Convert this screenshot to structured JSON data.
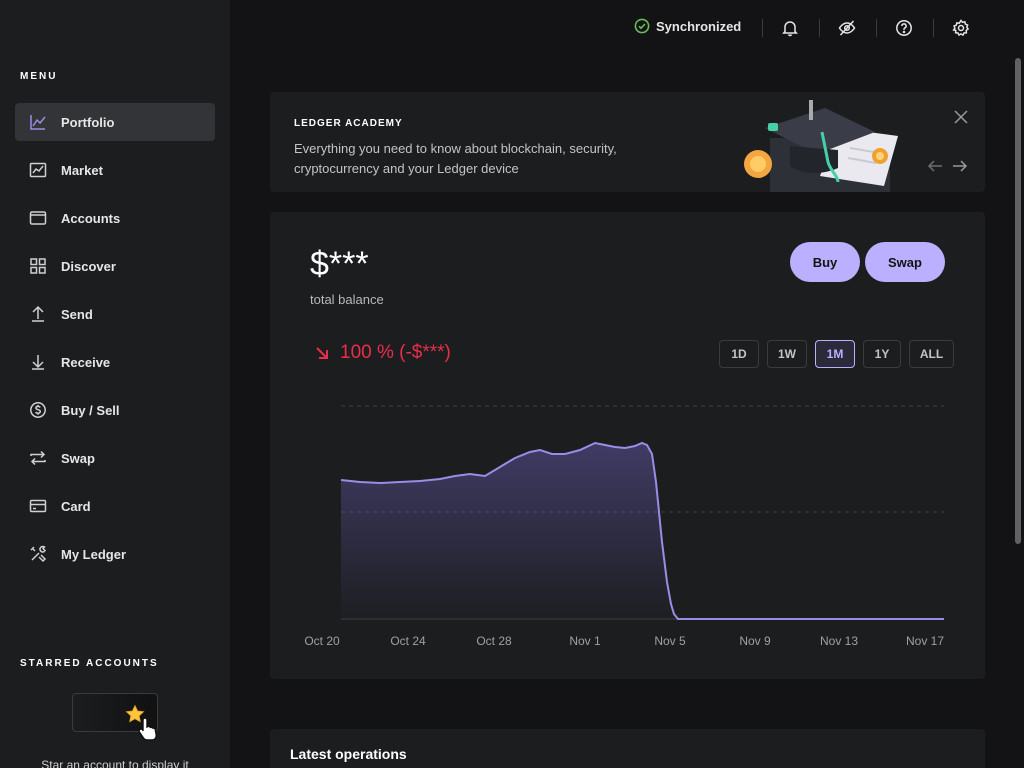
{
  "sidebar": {
    "menu_title": "MENU",
    "items": [
      {
        "label": "Portfolio",
        "icon": "portfolio-chart-icon",
        "active": true
      },
      {
        "label": "Market",
        "icon": "market-chart-icon"
      },
      {
        "label": "Accounts",
        "icon": "wallet-icon"
      },
      {
        "label": "Discover",
        "icon": "grid-icon"
      },
      {
        "label": "Send",
        "icon": "arrow-up-icon"
      },
      {
        "label": "Receive",
        "icon": "arrow-down-icon"
      },
      {
        "label": "Buy / Sell",
        "icon": "dollar-circle-icon"
      },
      {
        "label": "Swap",
        "icon": "swap-arrows-icon"
      },
      {
        "label": "Card",
        "icon": "card-icon"
      },
      {
        "label": "My Ledger",
        "icon": "tools-icon"
      }
    ],
    "starred_title": "STARRED ACCOUNTS",
    "starred_hint": "Star an account to display it"
  },
  "topbar": {
    "sync_label": "Synchronized",
    "sync_color": "#66be54",
    "icons": [
      "bell-icon",
      "eye-off-icon",
      "help-icon",
      "settings-icon"
    ]
  },
  "academy": {
    "title": "LEDGER ACADEMY",
    "text": "Everything you need to know about blockchain, security, cryptocurrency and your Ledger device"
  },
  "balance": {
    "value": "$***",
    "label": "total balance",
    "buy_label": "Buy",
    "swap_label": "Swap",
    "change": "100 % (-$***)",
    "change_color": "#ea2e49",
    "ranges": [
      "1D",
      "1W",
      "1M",
      "1Y",
      "ALL"
    ],
    "active_range": "1M"
  },
  "chart_data": {
    "type": "area",
    "x_labels": [
      "Oct 20",
      "Oct 24",
      "Oct 28",
      "Nov 1",
      "Nov 5",
      "Nov 9",
      "Nov 13",
      "Nov 17"
    ],
    "grid": true,
    "line_color": "#9a8de6"
  },
  "operations": {
    "title": "Latest operations"
  },
  "colors": {
    "accent": "#bbb0ff",
    "background": "#131214",
    "panel": "#1c1d1f"
  }
}
